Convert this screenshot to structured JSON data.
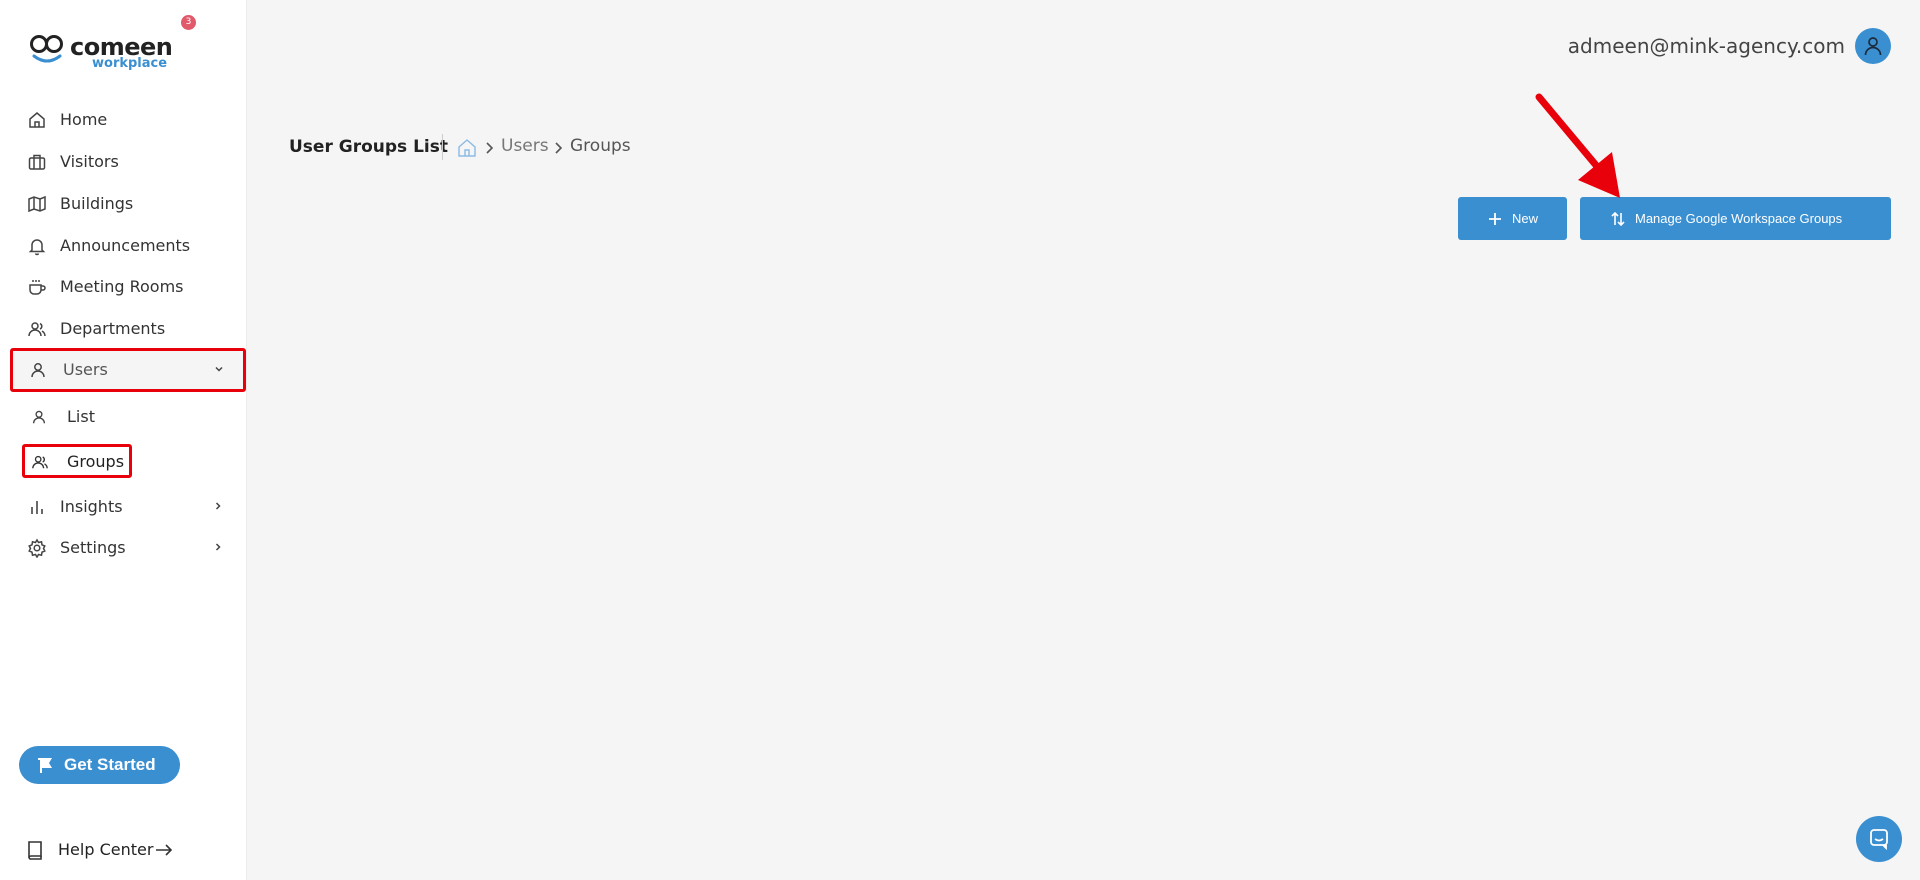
{
  "brand": {
    "name": "comeen",
    "sub": "workplace",
    "notification_count": "3"
  },
  "sidebar": {
    "items": [
      {
        "label": "Home",
        "icon": "home-icon"
      },
      {
        "label": "Visitors",
        "icon": "briefcase-icon"
      },
      {
        "label": "Buildings",
        "icon": "map-icon"
      },
      {
        "label": "Announcements",
        "icon": "bell-icon"
      },
      {
        "label": "Meeting Rooms",
        "icon": "coffee-icon"
      },
      {
        "label": "Departments",
        "icon": "users-icon"
      },
      {
        "label": "Users",
        "icon": "user-icon",
        "expanded": true
      },
      {
        "label": "Insights",
        "icon": "bar-chart-icon"
      },
      {
        "label": "Settings",
        "icon": "gear-icon"
      }
    ],
    "users_subitems": [
      {
        "label": "List",
        "icon": "user-icon"
      },
      {
        "label": "Groups",
        "icon": "users-icon",
        "active": true
      }
    ],
    "get_started": "Get Started",
    "help_center": "Help Center"
  },
  "header": {
    "user_email": "admeen@mink-agency.com"
  },
  "breadcrumb": {
    "page_title": "User Groups List",
    "crumbs": [
      "Users",
      "Groups"
    ]
  },
  "actions": {
    "new_label": "New",
    "manage_label": "Manage Google Workspace Groups"
  },
  "colors": {
    "accent": "#3a8fd1",
    "highlight": "#e8000b",
    "background": "#f5f5f5",
    "badge": "#e05a6b"
  }
}
